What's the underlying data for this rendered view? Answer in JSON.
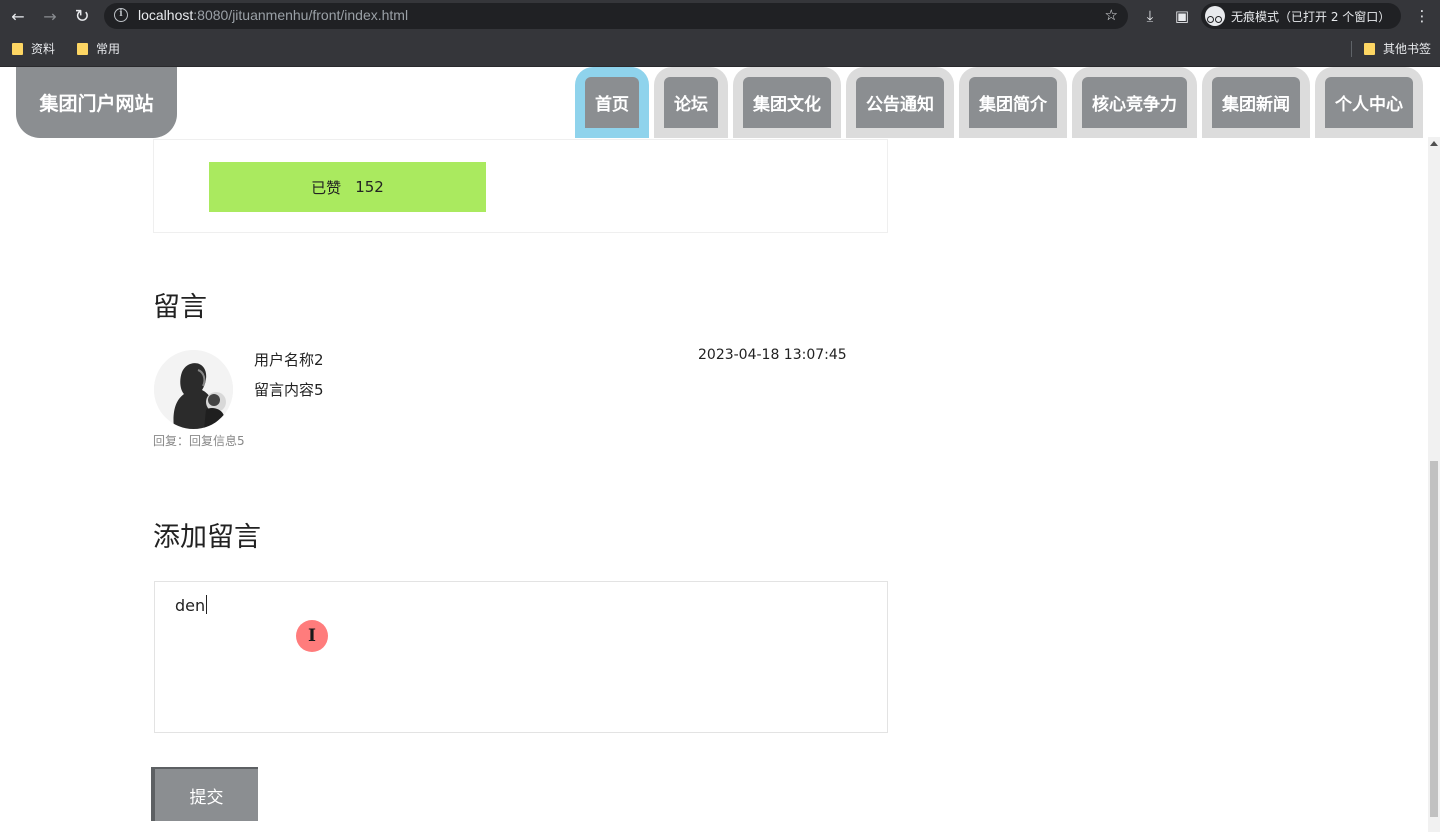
{
  "browser": {
    "url_host": "localhost",
    "url_rest": ":8080/jituanmenhu/front/index.html",
    "incognito_label": "无痕模式（已打开 2 个窗口）",
    "bookmarks": [
      "资料",
      "常用"
    ],
    "other_bookmarks": "其他书签"
  },
  "header": {
    "logo": "集团门户网站",
    "nav": [
      {
        "label": "首页",
        "active": true
      },
      {
        "label": "论坛"
      },
      {
        "label": "集团文化"
      },
      {
        "label": "公告通知"
      },
      {
        "label": "集团简介"
      },
      {
        "label": "核心竞争力"
      },
      {
        "label": "集团新闻"
      },
      {
        "label": "个人中心"
      }
    ]
  },
  "like": {
    "label": "已赞",
    "count": "152"
  },
  "comments": {
    "title": "留言",
    "items": [
      {
        "user": "用户名称2",
        "content": "留言内容5",
        "time": "2023-04-18 13:07:45",
        "reply": "回复：回复信息5"
      }
    ]
  },
  "add_comment": {
    "title": "添加留言",
    "value": "den",
    "submit": "提交"
  },
  "colors": {
    "nav_active": "#8fd3ec",
    "nav_inner": "#8b8e91",
    "like_button": "#aaea5f",
    "cursor_highlight": "#ff5050"
  }
}
